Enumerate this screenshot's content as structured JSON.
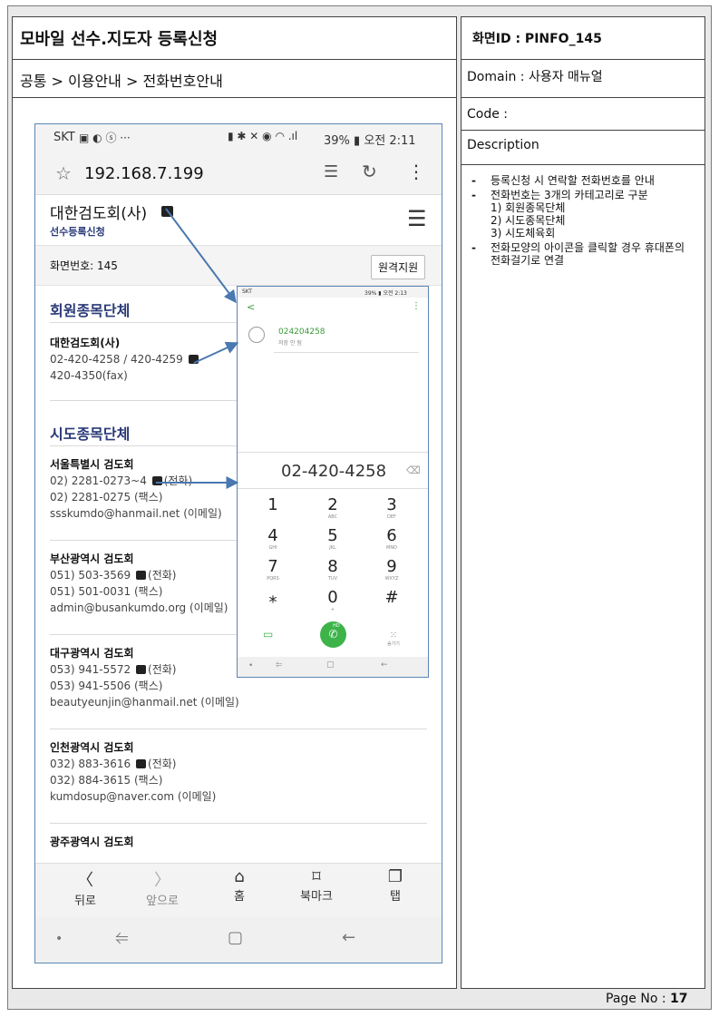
{
  "doc": {
    "title": "모바일 선수.지도자 등록신청",
    "breadcrumb": "공통 > 이용안내 > 전화번호안내",
    "screen_id": "화면ID : PINFO_145",
    "domain": "Domain : 사용자 매뉴얼",
    "code": "Code :",
    "description_label": "Description",
    "description_items": [
      "등록신청 시 연락할 전화번호를 안내",
      "전화번호는 3개의 카테고리로 구분",
      "전화모양의 아이콘을 클릭할 경우 휴대폰의 전화걸기로 연결"
    ],
    "categories": [
      "1) 회원종목단체",
      "2) 시도종목단체",
      "3) 시도체육회"
    ],
    "page_label": "Page No :",
    "page_number": "17"
  },
  "phone": {
    "status_left": "SKT",
    "status_right": "39% ▮ 오전 2:11",
    "url": "192.168.7.199",
    "site_title": "대한검도회(사)",
    "site_sub": "선수등록신청",
    "screen_no": "화면번호: 145",
    "remote_btn": "원격지원",
    "section1": "회원종목단체",
    "org1": {
      "name": "대한검도회(사)",
      "line1": "02-420-4258 / 420-4259",
      "line2": "420-4350(fax)"
    },
    "section2": "시도종목단체",
    "orgs": [
      {
        "name": "서울특별시 검도회",
        "line1": "02) 2281-0273~4",
        "line1_suffix": "(전화)",
        "line2": "02) 2281-0275 (팩스)",
        "line3": "ssskumdo@hanmail.net (이메일)"
      },
      {
        "name": "부산광역시 검도회",
        "line1": "051) 503-3569",
        "line1_suffix": "(전화)",
        "line2": "051) 501-0031 (팩스)",
        "line3": "admin@busankumdo.org (이메일)"
      },
      {
        "name": "대구광역시 검도회",
        "line1": "053) 941-5572",
        "line1_suffix": "(전화)",
        "line2": "053) 941-5506 (팩스)",
        "line3": "beautyeunjin@hanmail.net (이메일)"
      },
      {
        "name": "인천광역시 검도회",
        "line1": "032) 883-3616",
        "line1_suffix": "(전화)",
        "line2": "032) 884-3615 (팩스)",
        "line3": "kumdosup@naver.com (이메일)"
      },
      {
        "name": "광주광역시 검도회"
      }
    ],
    "nav": [
      {
        "label": "뒤로",
        "glyph": "〈"
      },
      {
        "label": "앞으로",
        "glyph": "〉"
      },
      {
        "label": "홈",
        "glyph": "⌂"
      },
      {
        "label": "북마크",
        "glyph": "⌑"
      },
      {
        "label": "탭",
        "glyph": "❐"
      }
    ]
  },
  "dialer": {
    "status_left": "SKT",
    "status_right": "39% ▮ 오전 2:13",
    "recent_number": "024204258",
    "recent_sub": "저장 안 됨",
    "dial_number": "02-420-4258",
    "keys": [
      {
        "d": "1",
        "s": ""
      },
      {
        "d": "2",
        "s": "ABC"
      },
      {
        "d": "3",
        "s": "DEF"
      },
      {
        "d": "4",
        "s": "GHI"
      },
      {
        "d": "5",
        "s": "JKL"
      },
      {
        "d": "6",
        "s": "MNO"
      },
      {
        "d": "7",
        "s": "PQRS"
      },
      {
        "d": "8",
        "s": "TUV"
      },
      {
        "d": "9",
        "s": "WXYZ"
      },
      {
        "d": "⁎",
        "s": ""
      },
      {
        "d": "0",
        "s": "+"
      },
      {
        "d": "#",
        "s": ""
      }
    ],
    "hd_label": "HD",
    "hide_label": "숨기기"
  },
  "colors": {
    "accent": "#2a3a78",
    "arrow": "#4a78b0",
    "green": "#3db34a",
    "link_green": "#3a9a3a"
  },
  "icons": [
    "star-icon",
    "reader-icon",
    "refresh-icon",
    "more-icon",
    "phone-icon",
    "hamburger-icon",
    "backspace-icon",
    "video-call-icon",
    "call-icon",
    "keypad-icon"
  ]
}
